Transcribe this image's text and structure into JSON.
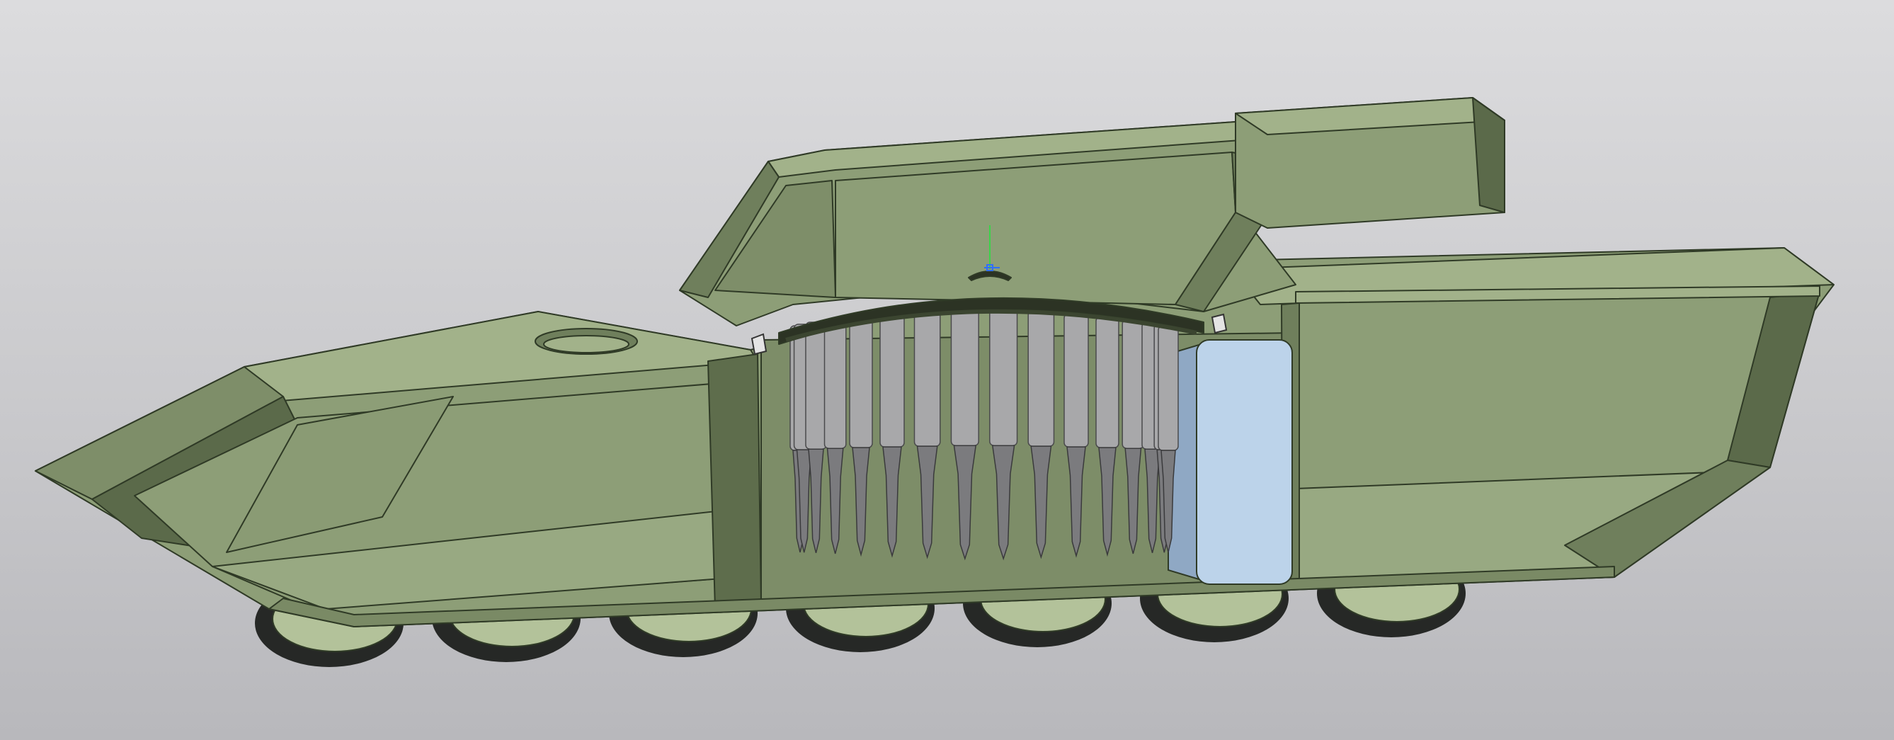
{
  "viewport": {
    "background_top": "#dcdcde",
    "background_bottom": "#b8b8bc"
  },
  "model": {
    "colors": {
      "hull": "#8d9e77",
      "hull_dark": "#6f7f5c",
      "hull_shadow": "#5b6a4a",
      "hull_light": "#a2b28a",
      "edge": "#2f3a26",
      "shell": "#a8a8aa",
      "shell_dark": "#7b7b7e",
      "tank": "#bcd3ea",
      "tank_dark": "#8fa8c4",
      "wheel": "#b3c29a",
      "tire": "#262826"
    },
    "road_wheel_count": 7,
    "autoloader_shell_count": 16,
    "axis_indicator_colors": [
      "#3cd34a",
      "#2f6fff"
    ]
  }
}
